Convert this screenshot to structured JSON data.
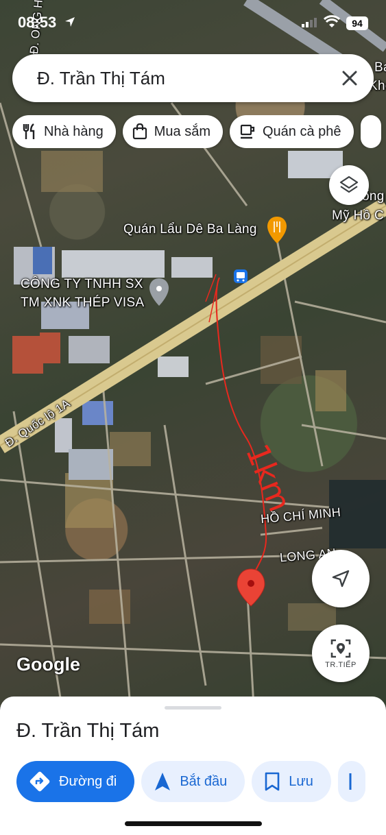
{
  "status_bar": {
    "time": "08:53",
    "battery": "94"
  },
  "search": {
    "query": "Đ. Trần Thị Tám"
  },
  "chips": [
    {
      "label": "Nhà hàng",
      "icon": "restaurant-icon"
    },
    {
      "label": "Mua sắm",
      "icon": "shopping-bag-icon"
    },
    {
      "label": "Quán cà phê",
      "icon": "coffee-icon"
    }
  ],
  "map": {
    "labels": {
      "restaurant_poi": "Quán Lẩu Dê Ba Làng",
      "company_line1": "CÔNG TY TNHH SX",
      "company_line2": "TM XNK THÉP VISA",
      "highway": "Đ. Quốc lộ 1A",
      "top_left_vertical": "Đ. ONG HỒ THỊ",
      "top_right_1": "Ba",
      "top_right_2": "Khô",
      "right_1": "ống",
      "right_2": "Mỹ Hồ C",
      "road_hcm": "HỒ CHÍ MINH",
      "road_la": "LONG AN",
      "annotation": "1km"
    },
    "provider": "Google",
    "colors": {
      "highway": "#d9c98f",
      "annotation": "#e8281e",
      "pin": "#ea4335"
    }
  },
  "fabs": {
    "live_label": "TR.TIẾP"
  },
  "sheet": {
    "place_name": "Đ. Trần Thị Tám",
    "actions": [
      {
        "label": "Đường đi",
        "icon": "directions-icon"
      },
      {
        "label": "Bắt đầu",
        "icon": "navigation-arrow-icon"
      },
      {
        "label": "Lưu",
        "icon": "bookmark-icon"
      }
    ]
  }
}
